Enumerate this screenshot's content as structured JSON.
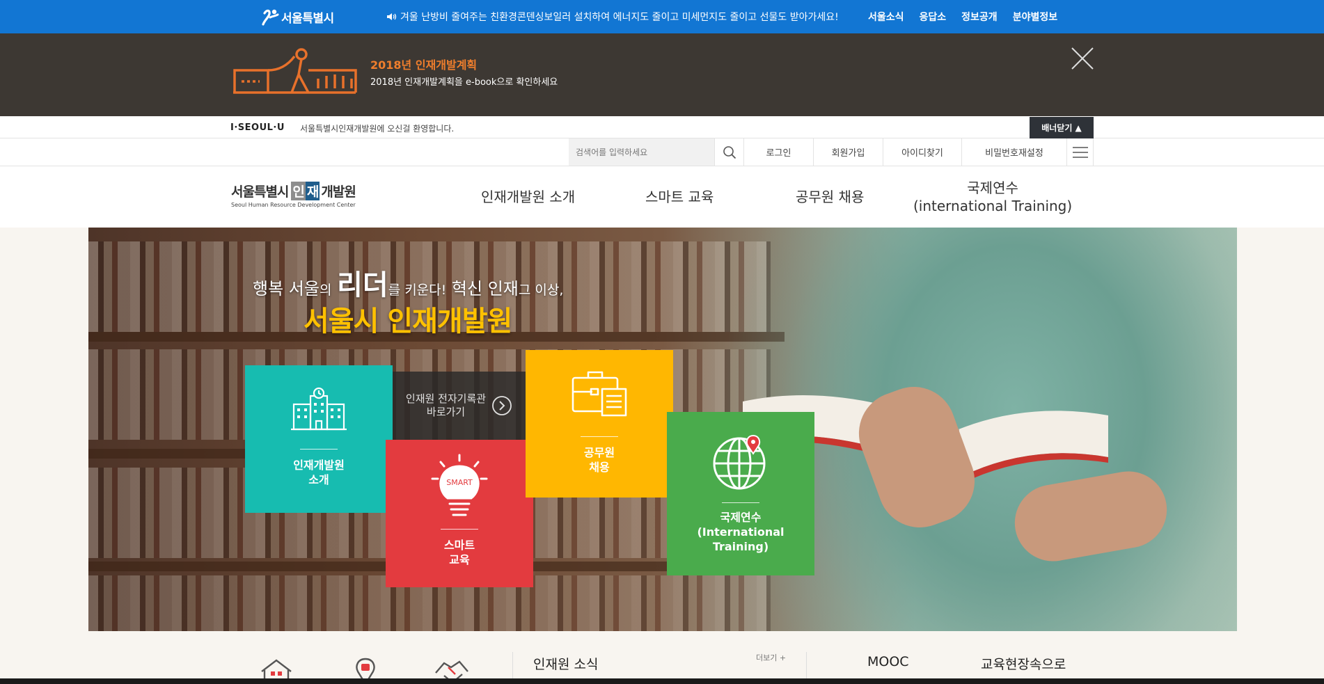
{
  "topbar": {
    "logo_text": "서울특별시",
    "news_text": "겨울 난방비 줄여주는 친환경콘덴싱보일러 설치하여 에너지도 줄이고 미세먼지도 줄이고 선물도 받아가세요!",
    "links": [
      "서울소식",
      "응답소",
      "정보공개",
      "분야별정보"
    ],
    "color": "#1276d3"
  },
  "promo": {
    "title": "2018년 인재개발계획",
    "subtitle": "2018년 인재개발계획을 e-book으로 확인하세요",
    "title_color": "#f07e2c",
    "background": "#3d3833"
  },
  "welcome": {
    "brand": "I·SEOUL·U",
    "text": "서울특별시인재개발원에 오신걸 환영합니다.",
    "banner_close": "배너닫기 ▲"
  },
  "utility": {
    "search_placeholder": "검색어를 입력하세요",
    "links": [
      "로그인",
      "회원가입",
      "아이디찾기",
      "비밀번호재설정"
    ]
  },
  "brand": {
    "ko_prefix": "서울특별시",
    "ko_box1": "인",
    "ko_box2": "재",
    "ko_rest": "개발원",
    "en": "Seoul Human Resource Development Center"
  },
  "nav": [
    {
      "label": "인재개발원 소개"
    },
    {
      "label": "스마트 교육"
    },
    {
      "label": "공무원 채용"
    },
    {
      "label": "국제연수\n(international Training)"
    }
  ],
  "hero": {
    "tagline_parts": {
      "a": "행복 서울",
      "b": "의",
      "c": "리더",
      "d": "를 키운다!",
      "e": "혁신 인재",
      "f": "그 이상,"
    },
    "headline": "서울시 인재개발원",
    "headline_color": "#ffc100",
    "archive": "인재원 전자기록관\n바로가기",
    "smart_badge": "SMART",
    "tiles": [
      {
        "label": "인재개발원\n소개",
        "color": "#17bcb0",
        "icon": "building-icon"
      },
      {
        "label": "스마트\n교육",
        "color": "#e33b3f",
        "icon": "lightbulb-icon"
      },
      {
        "label": "공무원\n채용",
        "color": "#ffb701",
        "icon": "briefcase-icon"
      },
      {
        "label": "국제연수\n(International\nTraining)",
        "color": "#4aab4c",
        "icon": "globe-pin-icon"
      }
    ]
  },
  "bottom": {
    "news_title": "인재원 소식",
    "more": "더보기 +",
    "mooc": "MOOC",
    "field": "교육현장속으로"
  }
}
